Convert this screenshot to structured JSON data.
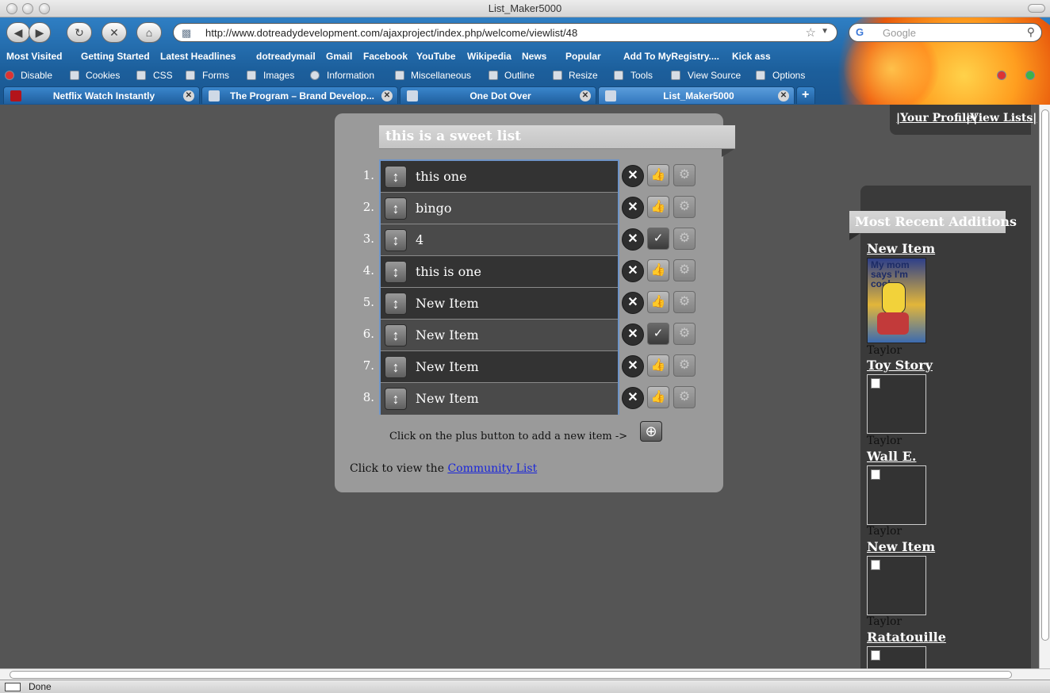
{
  "window": {
    "title": "List_Maker5000"
  },
  "nav": {
    "url": "http://www.dotreadydevelopment.com/ajaxproject/index.php/welcome/viewlist/48",
    "search_placeholder": "Google"
  },
  "bookmarks": [
    "Most Visited",
    "Getting Started",
    "Latest Headlines",
    "dotreadymail",
    "Gmail",
    "Facebook",
    "YouTube",
    "Wikipedia",
    "News",
    "Popular",
    "Add To MyRegistry....",
    "Kick ass"
  ],
  "devtools": [
    "Disable",
    "Cookies",
    "CSS",
    "Forms",
    "Images",
    "Information",
    "Miscellaneous",
    "Outline",
    "Resize",
    "Tools",
    "View Source",
    "Options"
  ],
  "tabs": [
    {
      "label": "Netflix Watch Instantly"
    },
    {
      "label": "The Program – Brand Develop..."
    },
    {
      "label": "One Dot Over"
    },
    {
      "label": "List_Maker5000"
    }
  ],
  "status": "Done",
  "page": {
    "topnav": {
      "profile": "|Your Profile|",
      "view_lists": "|View Lists|"
    },
    "list_title": "this is a sweet list",
    "items": [
      {
        "num": "1.",
        "label": "this one",
        "liked": false
      },
      {
        "num": "2.",
        "label": "bingo",
        "liked": false
      },
      {
        "num": "3.",
        "label": "4",
        "liked": true
      },
      {
        "num": "4.",
        "label": "this is one",
        "liked": false
      },
      {
        "num": "5.",
        "label": "New Item",
        "liked": false
      },
      {
        "num": "6.",
        "label": "New Item",
        "liked": true
      },
      {
        "num": "7.",
        "label": "New Item",
        "liked": false
      },
      {
        "num": "8.",
        "label": "New Item",
        "liked": false
      }
    ],
    "add_hint": "Click on the plus button to add a new item ->",
    "community_prefix": "Click to view the",
    "community_link": "Community List",
    "recent": {
      "heading": "Most Recent Additions",
      "poster_text": "My mom says I'm cool.",
      "entries": [
        {
          "title": "New Item",
          "user": "Taylor"
        },
        {
          "title": "Toy Story",
          "user": "Taylor"
        },
        {
          "title": "Wall E.",
          "user": "Taylor"
        },
        {
          "title": "New Item",
          "user": "Taylor"
        },
        {
          "title": "Ratatouille",
          "user": ""
        }
      ]
    }
  }
}
